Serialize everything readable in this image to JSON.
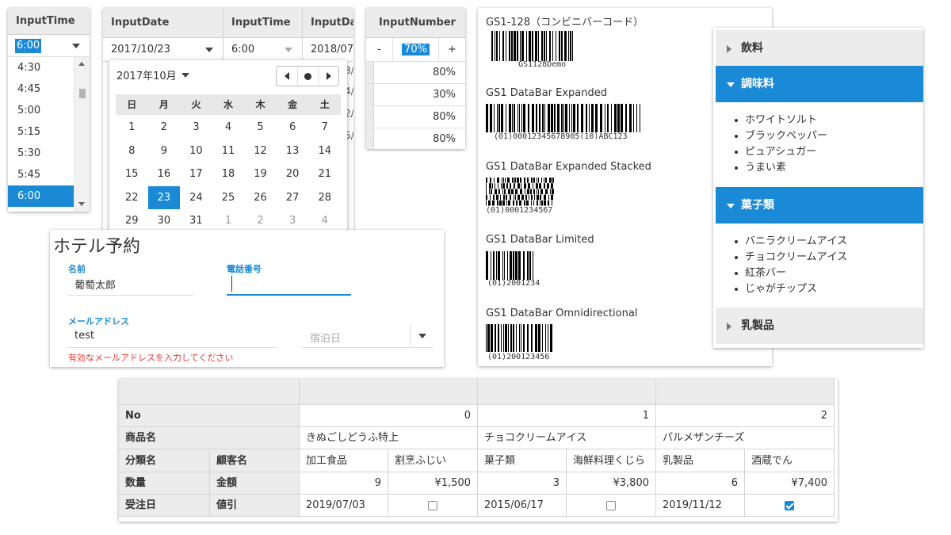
{
  "input_time_list": {
    "header": "InputTime",
    "value": "6:00",
    "items": [
      "4:30",
      "4:45",
      "5:00",
      "5:15",
      "5:30",
      "5:45",
      "6:00"
    ],
    "selected": "6:00"
  },
  "input_date": {
    "headers": [
      "InputDate",
      "InputTime",
      "InputDat"
    ],
    "row": {
      "date": "2017/10/23",
      "time": "6:00",
      "date2": "2018/07/"
    },
    "fragments": [
      "3/",
      "4/",
      "2/",
      "5/"
    ],
    "calendar": {
      "month_title": "2017年10月",
      "weekdays": [
        "日",
        "月",
        "火",
        "水",
        "木",
        "金",
        "土"
      ],
      "days": [
        {
          "d": "1",
          "o": false
        },
        {
          "d": "2",
          "o": false
        },
        {
          "d": "3",
          "o": false
        },
        {
          "d": "4",
          "o": false
        },
        {
          "d": "5",
          "o": false
        },
        {
          "d": "6",
          "o": false
        },
        {
          "d": "7",
          "o": false
        },
        {
          "d": "8",
          "o": false
        },
        {
          "d": "9",
          "o": false
        },
        {
          "d": "10",
          "o": false
        },
        {
          "d": "11",
          "o": false
        },
        {
          "d": "12",
          "o": false
        },
        {
          "d": "13",
          "o": false
        },
        {
          "d": "14",
          "o": false
        },
        {
          "d": "15",
          "o": false
        },
        {
          "d": "16",
          "o": false
        },
        {
          "d": "17",
          "o": false
        },
        {
          "d": "18",
          "o": false
        },
        {
          "d": "19",
          "o": false
        },
        {
          "d": "20",
          "o": false
        },
        {
          "d": "21",
          "o": false
        },
        {
          "d": "22",
          "o": false
        },
        {
          "d": "23",
          "o": false
        },
        {
          "d": "24",
          "o": false
        },
        {
          "d": "25",
          "o": false
        },
        {
          "d": "26",
          "o": false
        },
        {
          "d": "27",
          "o": false
        },
        {
          "d": "28",
          "o": false
        },
        {
          "d": "29",
          "o": false
        },
        {
          "d": "30",
          "o": false
        },
        {
          "d": "31",
          "o": false
        },
        {
          "d": "1",
          "o": true
        },
        {
          "d": "2",
          "o": true
        },
        {
          "d": "3",
          "o": true
        },
        {
          "d": "4",
          "o": true
        }
      ],
      "selected_day": "23"
    }
  },
  "input_number": {
    "header": "InputNumber",
    "minus": "-",
    "value": "70%",
    "plus": "+",
    "rows": [
      "80%",
      "30%",
      "80%",
      "80%"
    ]
  },
  "hotel": {
    "title": "ホテル予約",
    "name_label": "名前",
    "name_value": "葡萄太郎",
    "phone_label": "電話番号",
    "email_label": "メールアドレス",
    "email_value": "test",
    "date_placeholder": "宿泊日",
    "error": "有効なメールアドレスを入力してください"
  },
  "barcodes": [
    {
      "title": "GS1-128（コンビニバーコード）",
      "caption": "GS1128Demo"
    },
    {
      "title": "GS1 DataBar Expanded",
      "caption": "(01)00012345678905(10)ABC123"
    },
    {
      "title": "GS1 DataBar Expanded Stacked",
      "caption": "(01)0001234567"
    },
    {
      "title": "GS1 DataBar Limited",
      "caption": "(01)2001234"
    },
    {
      "title": "GS1 DataBar Omnidirectional",
      "caption": "(01)200123456"
    }
  ],
  "accordion": {
    "sections": [
      {
        "title": "飲料",
        "open": false,
        "items": []
      },
      {
        "title": "調味料",
        "open": true,
        "items": [
          "ホワイトソルト",
          "ブラックペッパー",
          "ピュアシュガー",
          "うまい素"
        ]
      },
      {
        "title": "菓子類",
        "open": true,
        "items": [
          "バニラクリームアイス",
          "チョコクリームアイス",
          "紅茶バー",
          "じゃがチップス"
        ]
      },
      {
        "title": "乳製品",
        "open": false,
        "items": []
      }
    ]
  },
  "grid": {
    "row_headers": {
      "no": "No",
      "product": "商品名",
      "category": "分類名",
      "customer": "顧客名",
      "qty": "数量",
      "amount": "金額",
      "order_date": "受注日",
      "discount": "値引"
    },
    "records": [
      {
        "no": "0",
        "product": "きぬごしどうふ特上",
        "category": "加工食品",
        "customer": "割烹ふじい",
        "qty": "9",
        "amount": "¥1,500",
        "date": "2019/07/03",
        "discount": false
      },
      {
        "no": "1",
        "product": "チョコクリームアイス",
        "category": "菓子類",
        "customer": "海鮮料理くじら",
        "qty": "3",
        "amount": "¥3,800",
        "date": "2015/06/17",
        "discount": false
      },
      {
        "no": "2",
        "product": "パルメザンチーズ",
        "category": "乳製品",
        "customer": "酒蔵でん",
        "qty": "6",
        "amount": "¥7,400",
        "date": "2019/11/12",
        "discount": true
      }
    ]
  },
  "colors": {
    "accent": "#1a89d6",
    "header_bg": "#ececec",
    "error": "#e53935"
  }
}
